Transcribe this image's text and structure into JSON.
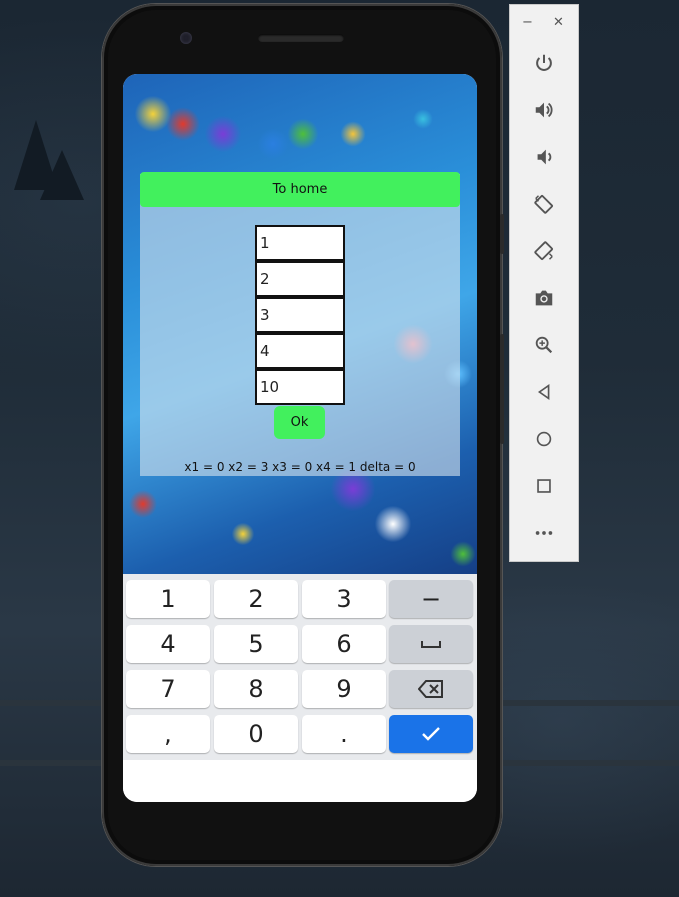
{
  "app": {
    "home_button_label": "To home",
    "inputs": [
      {
        "value": "1"
      },
      {
        "value": "2"
      },
      {
        "value": "3"
      },
      {
        "value": "4"
      },
      {
        "value": "10"
      }
    ],
    "ok_button_label": "Ok",
    "result_text": "x1 = 0 x2 = 3 x3 = 0 x4 = 1 delta = 0"
  },
  "keyboard": {
    "rows": [
      [
        "1",
        "2",
        "3",
        "−"
      ],
      [
        "4",
        "5",
        "6",
        "space-icon"
      ],
      [
        "7",
        "8",
        "9",
        "backspace-icon"
      ],
      [
        ",",
        "0",
        ".",
        "check-icon"
      ]
    ],
    "keys": {
      "k1": "1",
      "k2": "2",
      "k3": "3",
      "minus": "−",
      "k4": "4",
      "k5": "5",
      "k6": "6",
      "k7": "7",
      "k8": "8",
      "k9": "9",
      "comma": ",",
      "k0": "0",
      "period": "."
    },
    "colors": {
      "done_key": "#1a73e8",
      "function_key": "#ccd0d6"
    }
  },
  "accent_colors": {
    "green_button": "#42f05d"
  },
  "emulator_toolbar": {
    "window_controls": {
      "minimize": "−",
      "close": "✕"
    },
    "buttons": [
      "power-icon",
      "volume-up-icon",
      "volume-down-icon",
      "rotate-left-icon",
      "rotate-right-icon",
      "camera-icon",
      "zoom-icon",
      "back-icon",
      "home-icon",
      "overview-icon",
      "more-icon"
    ]
  }
}
